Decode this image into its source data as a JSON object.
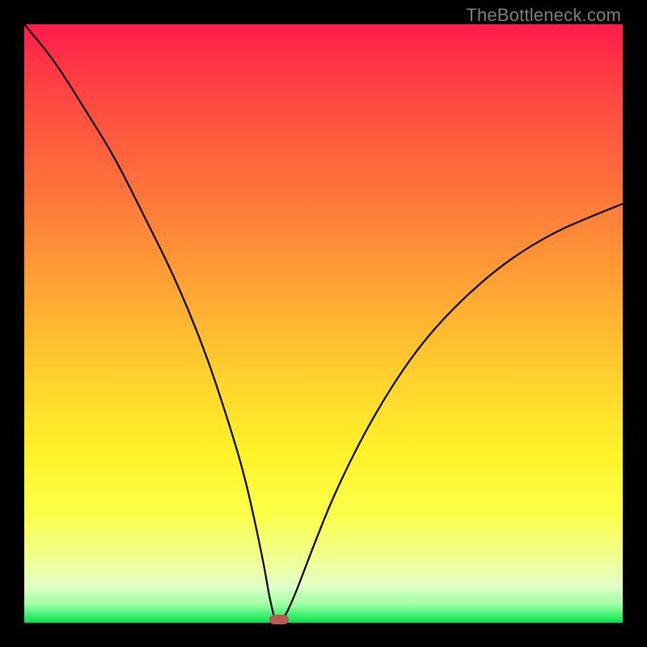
{
  "watermark": "TheBottleneck.com",
  "chart_data": {
    "type": "line",
    "title": "",
    "xlabel": "",
    "ylabel": "",
    "xlim": [
      0,
      100
    ],
    "ylim": [
      0,
      100
    ],
    "grid": false,
    "legend": false,
    "x": [
      0,
      5,
      10,
      15,
      20,
      25,
      30,
      34,
      37,
      40,
      41,
      42,
      43,
      45,
      48,
      52,
      58,
      65,
      72,
      80,
      88,
      95,
      100
    ],
    "y": [
      100,
      94,
      86,
      78,
      68,
      58,
      46,
      34,
      24,
      10,
      4,
      0,
      0,
      4,
      12,
      22,
      34,
      45,
      53,
      60,
      65,
      68,
      70
    ],
    "optimal_point": {
      "x": 42.5,
      "y": 0
    },
    "gradient_colors": {
      "top": "#ff1a4d",
      "mid_high": "#ff8c38",
      "mid": "#ffe62e",
      "mid_low": "#e8ffb3",
      "bottom": "#00e54a"
    },
    "curve_color": "#000000",
    "marker_color": "#b85a55"
  }
}
